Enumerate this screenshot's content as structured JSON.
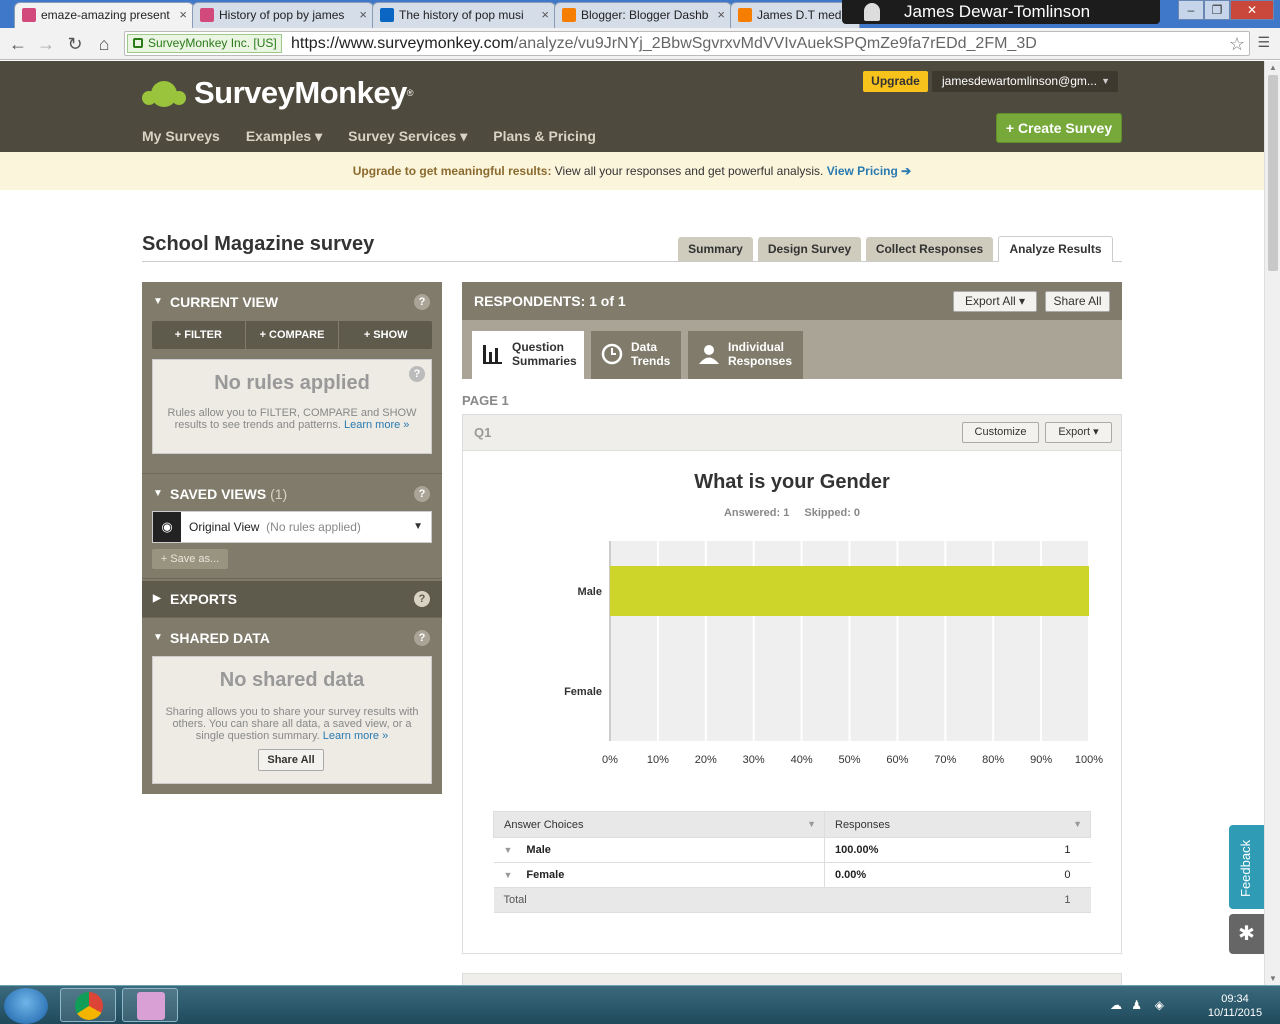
{
  "browser": {
    "tabs": [
      {
        "title": "emaze-amazing present",
        "favicon_color": "#d24a7b"
      },
      {
        "title": "History of pop by james",
        "favicon_color": "#d24a7b"
      },
      {
        "title": "The history of pop musi",
        "favicon_color": "#0a66c2"
      },
      {
        "title": "Blogger: Blogger Dashb",
        "favicon_color": "#f57d00"
      },
      {
        "title": "James D.T medi",
        "favicon_color": "#f57d00"
      }
    ],
    "tab_close_glyph": "×",
    "profile_name": "James Dewar-Tomlinson",
    "secure_label": "SurveyMonkey Inc. [US]",
    "url_host": "https://www.surveymonkey.com",
    "url_path": "/analyze/vu9JrNYj_2BbwSgvrxvMdVVIvAuekSPQmZe9fa7rEDd_2FM_3D"
  },
  "header": {
    "logo_text": "SurveyMonkey",
    "logo_reg": "®",
    "upgrade_label": "Upgrade",
    "account_label": "jamesdewartomlinson@gm...",
    "nav": [
      "My Surveys",
      "Examples ▾",
      "Survey Services ▾",
      "Plans & Pricing"
    ],
    "create_label": "+ Create Survey",
    "brand_green": "#9bc43d",
    "header_bg": "#4e4a3d"
  },
  "banner": {
    "strong": "Upgrade to get meaningful results:",
    "text": " View all your responses and get powerful analysis. ",
    "link": "View Pricing ➔"
  },
  "survey": {
    "title": "School Magazine survey",
    "tabs": [
      "Summary",
      "Design Survey",
      "Collect Responses",
      "Analyze Results"
    ],
    "active_tab": "Analyze Results"
  },
  "sidebar": {
    "current_view": "CURRENT VIEW",
    "filter": "+ FILTER",
    "compare": "+ COMPARE",
    "show": "+ SHOW",
    "no_rules_title": "No rules applied",
    "no_rules_text": "Rules allow you to FILTER, COMPARE and SHOW results to see trends and patterns.",
    "learn_more": "Learn more »",
    "saved_views": "SAVED VIEWS",
    "saved_count": "(1)",
    "view_name": "Original View",
    "view_note": "(No rules applied)",
    "save_as": "+ Save as...",
    "exports": "EXPORTS",
    "shared_data": "SHARED DATA",
    "no_shared_title": "No shared data",
    "no_shared_text": "Sharing allows you to share your survey results with others. You can share all data, a saved view, or a single question summary.",
    "share_all": "Share All",
    "help": "?"
  },
  "main": {
    "respondents": "RESPONDENTS: 1 of 1",
    "export_all": "Export All ▾",
    "share_all": "Share All",
    "view_tabs": [
      {
        "line1": "Question",
        "line2": "Summaries"
      },
      {
        "line1": "Data",
        "line2": "Trends"
      },
      {
        "line1": "Individual",
        "line2": "Responses"
      }
    ],
    "page_label": "PAGE 1",
    "question": {
      "number": "Q1",
      "customize": "Customize",
      "export": "Export ▾",
      "title": "What is your Gender",
      "answered": "Answered: 1",
      "skipped": "Skipped: 0"
    },
    "table": {
      "col_choices": "Answer Choices",
      "col_responses": "Responses",
      "rows": [
        {
          "choice": "Male",
          "percent": "100.00%",
          "count": "1"
        },
        {
          "choice": "Female",
          "percent": "0.00%",
          "count": "0"
        }
      ],
      "total_label": "Total",
      "total_count": "1"
    }
  },
  "chart_data": {
    "type": "bar",
    "orientation": "horizontal",
    "categories": [
      "Male",
      "Female"
    ],
    "values": [
      100,
      0
    ],
    "title": "What is your Gender",
    "xlabel": "",
    "ylabel": "",
    "xlim": [
      0,
      100
    ],
    "x_ticks": [
      "0%",
      "10%",
      "20%",
      "30%",
      "40%",
      "50%",
      "60%",
      "70%",
      "80%",
      "90%",
      "100%"
    ],
    "grid": true,
    "bar_color": "#cdd52a"
  },
  "widgets": {
    "feedback": "Feedback"
  },
  "taskbar": {
    "time": "09:34",
    "date": "10/11/2015"
  }
}
